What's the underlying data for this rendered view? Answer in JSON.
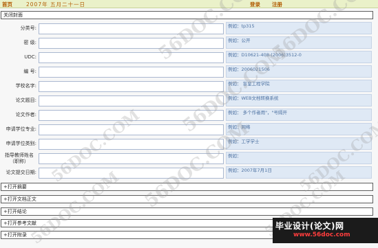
{
  "topbar": {
    "home": "首页",
    "date": "2007年 五月二十一日",
    "login": "登录",
    "register": "注册"
  },
  "sections": {
    "close_cover": "关闭封面",
    "abstract": "+打开摘要",
    "body": "+打开文档正文",
    "conclusion": "+打开结论",
    "references": "+打开参考文献",
    "appendix": "+打开附录"
  },
  "fields": [
    {
      "label": "分类号:",
      "hint": "例如：tp315",
      "value": ""
    },
    {
      "label": "密  级:",
      "hint": "例如：公开",
      "value": ""
    },
    {
      "label": "UDC:",
      "hint": "例如：D10621-408-(2006)3512-0",
      "value": ""
    },
    {
      "label": "编  号:",
      "hint": "例如：2006021506",
      "value": ""
    },
    {
      "label": "学校名字:",
      "hint": "例如：  盲皇工程学院",
      "value": ""
    },
    {
      "label": "论文题目:",
      "hint": "例如：WEB文档转换系统",
      "value": ""
    },
    {
      "label": "论文作者:",
      "hint": "例如：  多个作者用\"，\"号隔开",
      "value": ""
    },
    {
      "label": "申请学位专业:",
      "hint": "例如：网络",
      "value": ""
    },
    {
      "label": "申请学位类别:",
      "hint": "例如：工学学士",
      "value": ""
    },
    {
      "label": "指导教师姓名（职称）",
      "hint": "例如：",
      "value": ""
    },
    {
      "label": "论文提交日期:",
      "hint": "例如：2007年7月1日",
      "value": ""
    }
  ],
  "watermark": "56DOC.COM",
  "brand": {
    "line1": "毕业设计(论文)网",
    "line2": "www.56doc.com"
  }
}
